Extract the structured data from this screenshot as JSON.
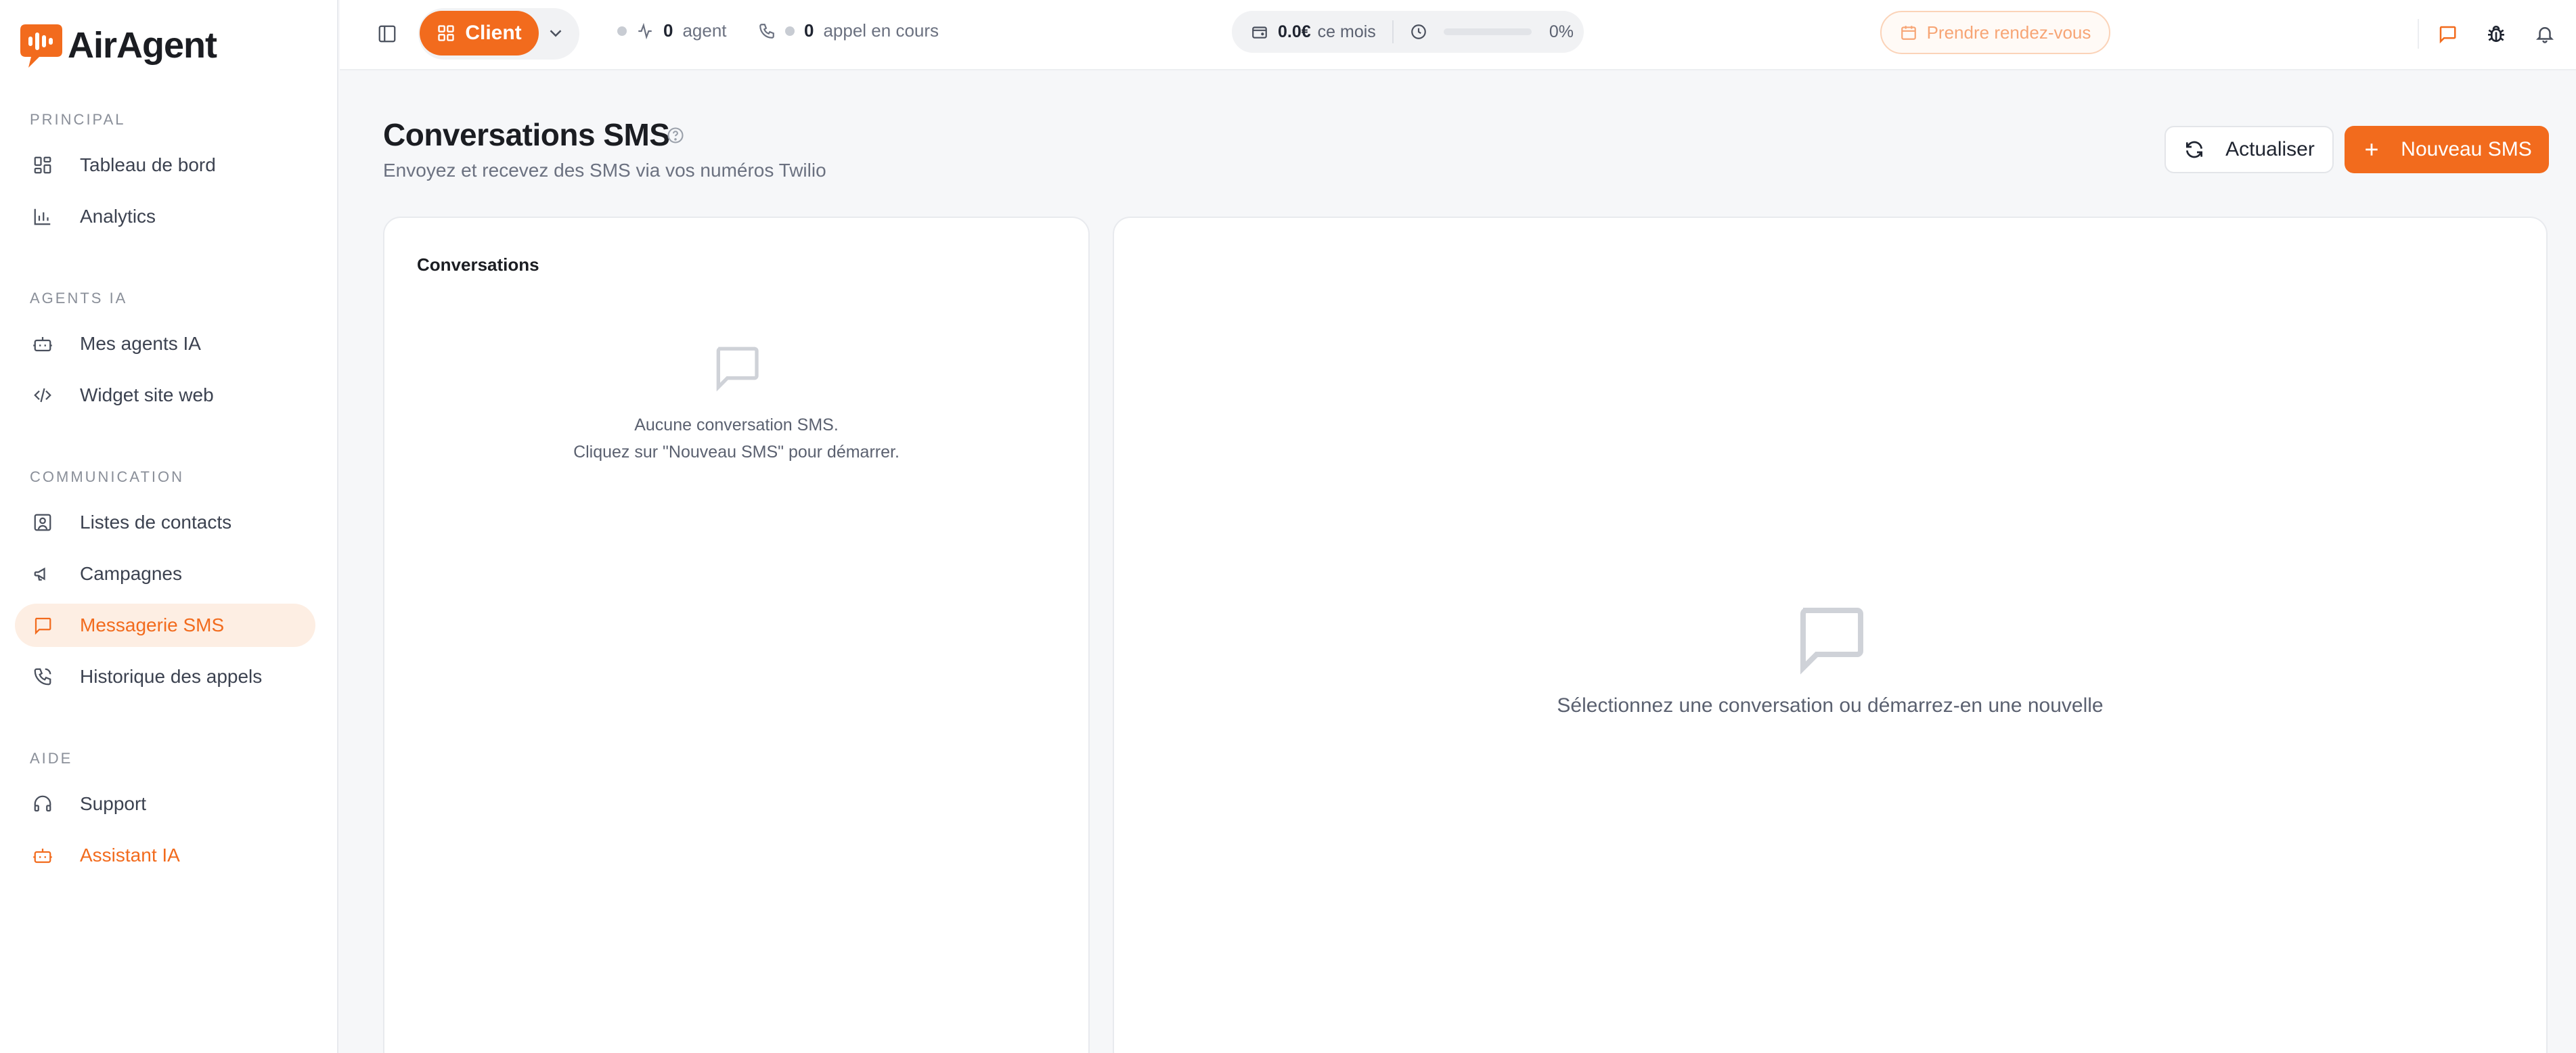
{
  "app": {
    "name": "AirAgent"
  },
  "sidebar": {
    "sections": [
      {
        "title": "PRINCIPAL",
        "items": [
          {
            "label": "Tableau de bord",
            "icon": "dashboard-icon"
          },
          {
            "label": "Analytics",
            "icon": "bar-chart-icon"
          }
        ]
      },
      {
        "title": "AGENTS IA",
        "items": [
          {
            "label": "Mes agents IA",
            "icon": "bot-icon"
          },
          {
            "label": "Widget site web",
            "icon": "code-icon"
          }
        ]
      },
      {
        "title": "COMMUNICATION",
        "items": [
          {
            "label": "Listes de contacts",
            "icon": "contacts-icon"
          },
          {
            "label": "Campagnes",
            "icon": "megaphone-icon"
          },
          {
            "label": "Messagerie SMS",
            "icon": "message-icon",
            "active": true
          },
          {
            "label": "Historique des appels",
            "icon": "phone-history-icon"
          }
        ]
      },
      {
        "title": "AIDE",
        "items": [
          {
            "label": "Support",
            "icon": "headset-icon"
          },
          {
            "label": "Assistant IA",
            "icon": "bot-icon"
          }
        ]
      }
    ]
  },
  "topbar": {
    "role_label": "Client",
    "agents_count": "0",
    "agents_label": "agent",
    "calls_count": "0",
    "calls_label": "appel en cours",
    "cost_value": "0.0€",
    "cost_label": "ce mois",
    "usage_percent_label": "0%",
    "usage_percent": 0,
    "appointment_label": "Prendre rendez-vous"
  },
  "main": {
    "title": "Conversations SMS",
    "subtitle": "Envoyez et recevez des SMS via vos numéros Twilio",
    "refresh_label": "Actualiser",
    "new_sms_label": "Nouveau SMS",
    "conversations_title": "Conversations",
    "empty_list_line1": "Aucune conversation SMS.",
    "empty_list_line2": "Cliquez sur \"Nouveau SMS\" pour démarrer.",
    "empty_detail": "Sélectionnez une conversation ou démarrez-en une nouvelle"
  },
  "colors": {
    "accent": "#f26b1d",
    "accent_light": "#fdeee3"
  }
}
